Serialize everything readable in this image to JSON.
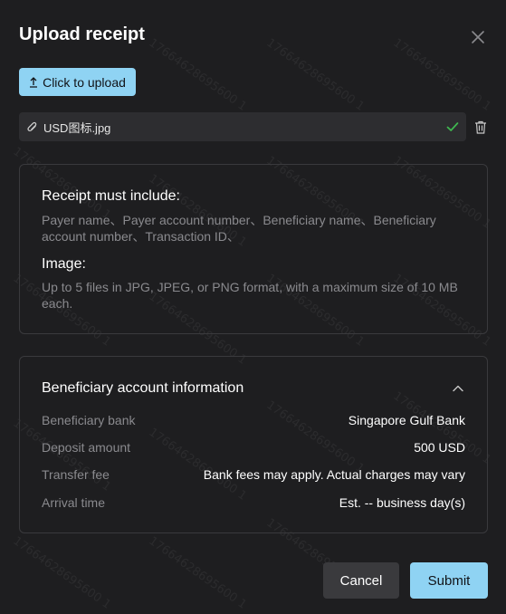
{
  "dialog": {
    "title": "Upload receipt"
  },
  "upload": {
    "button_label": "Click to upload",
    "file_name": "USD图标.jpg"
  },
  "requirements": {
    "receipt_heading": "Receipt must include:",
    "receipt_text": "Payer name、Payer account number、Beneficiary name、Beneficiary account number、Transaction ID、",
    "image_heading": "Image:",
    "image_text": "Up to 5 files in JPG, JPEG, or PNG format, with a maximum size of 10 MB each."
  },
  "beneficiary": {
    "title": "Beneficiary account information",
    "rows": [
      {
        "label": "Beneficiary bank",
        "value": "Singapore Gulf Bank"
      },
      {
        "label": "Deposit amount",
        "value": "500 USD"
      },
      {
        "label": "Transfer fee",
        "value": "Bank fees may apply. Actual charges may vary"
      },
      {
        "label": "Arrival time",
        "value": "Est. -- business day(s)"
      }
    ]
  },
  "footer": {
    "cancel_label": "Cancel",
    "submit_label": "Submit"
  },
  "watermark": {
    "text": "17664628695600 1"
  },
  "colors": {
    "accent": "#8fd3f3",
    "success": "#3fb950",
    "background": "#1e1e20"
  },
  "icons": {
    "close": "close-icon",
    "upload": "upload-arrow-icon",
    "attachment": "paperclip-icon",
    "success": "check-icon",
    "delete": "trash-icon",
    "collapse": "chevron-up-icon"
  }
}
